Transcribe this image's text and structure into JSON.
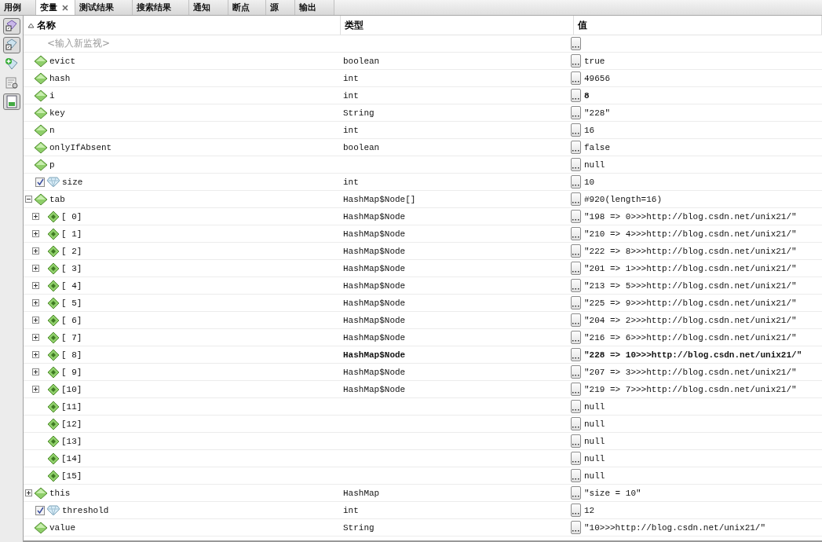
{
  "tabs": [
    {
      "label": "用例",
      "selected": false
    },
    {
      "label": "变量",
      "selected": true
    },
    {
      "label": "测试结果",
      "selected": false
    },
    {
      "label": "搜索结果",
      "selected": false
    },
    {
      "label": "通知",
      "selected": false
    },
    {
      "label": "断点",
      "selected": false
    },
    {
      "label": "源",
      "selected": false
    },
    {
      "label": "输出",
      "selected": false
    }
  ],
  "toolbar": [
    {
      "selected": true
    },
    {
      "selected": true
    },
    {
      "selected": false
    },
    {
      "selected": false
    },
    {
      "selected": true
    }
  ],
  "columns": [
    {
      "label": "名称",
      "sorted": true
    },
    {
      "label": "类型",
      "sorted": false
    },
    {
      "label": "值",
      "sorted": false
    }
  ],
  "new_watch": {
    "placeholder": "<输入新监视>"
  },
  "rows": [
    {
      "kind": "field",
      "name": "evict",
      "type": "boolean",
      "value": "true",
      "changed": false,
      "type_changed": false
    },
    {
      "kind": "field",
      "name": "hash",
      "type": "int",
      "value": "49656",
      "changed": false,
      "type_changed": false
    },
    {
      "kind": "field",
      "name": "i",
      "type": "int",
      "value": "8",
      "changed": true,
      "type_changed": false
    },
    {
      "kind": "field",
      "name": "key",
      "type": "String",
      "value": "\"228\"",
      "changed": false,
      "type_changed": false
    },
    {
      "kind": "field",
      "name": "n",
      "type": "int",
      "value": "16",
      "changed": false,
      "type_changed": false
    },
    {
      "kind": "field",
      "name": "onlyIfAbsent",
      "type": "boolean",
      "value": "false",
      "changed": false,
      "type_changed": false
    },
    {
      "kind": "field",
      "name": "p",
      "value": "null",
      "changed": false
    },
    {
      "kind": "watch",
      "checked": true,
      "name": "size",
      "type": "int",
      "value": "10",
      "changed": false,
      "type_changed": false
    },
    {
      "kind": "field",
      "name": "tab",
      "type": "HashMap$Node[]",
      "value": "#920(length=16)",
      "changed": false,
      "type_changed": false,
      "expanded": true,
      "children": [
        {
          "kind": "element",
          "name": "[ 0]",
          "type": "HashMap$Node",
          "value": "\"198 => 0>>>http://blog.csdn.net/unix21/\"",
          "changed": false,
          "type_changed": false,
          "expanded": false
        },
        {
          "kind": "element",
          "name": "[ 1]",
          "type": "HashMap$Node",
          "value": "\"210 => 4>>>http://blog.csdn.net/unix21/\"",
          "changed": false,
          "type_changed": false,
          "expanded": false
        },
        {
          "kind": "element",
          "name": "[ 2]",
          "type": "HashMap$Node",
          "value": "\"222 => 8>>>http://blog.csdn.net/unix21/\"",
          "changed": false,
          "type_changed": false,
          "expanded": false
        },
        {
          "kind": "element",
          "name": "[ 3]",
          "type": "HashMap$Node",
          "value": "\"201 => 1>>>http://blog.csdn.net/unix21/\"",
          "changed": false,
          "type_changed": false,
          "expanded": false
        },
        {
          "kind": "element",
          "name": "[ 4]",
          "type": "HashMap$Node",
          "value": "\"213 => 5>>>http://blog.csdn.net/unix21/\"",
          "changed": false,
          "type_changed": false,
          "expanded": false
        },
        {
          "kind": "element",
          "name": "[ 5]",
          "type": "HashMap$Node",
          "value": "\"225 => 9>>>http://blog.csdn.net/unix21/\"",
          "changed": false,
          "type_changed": false,
          "expanded": false
        },
        {
          "kind": "element",
          "name": "[ 6]",
          "type": "HashMap$Node",
          "value": "\"204 => 2>>>http://blog.csdn.net/unix21/\"",
          "changed": false,
          "type_changed": false,
          "expanded": false
        },
        {
          "kind": "element",
          "name": "[ 7]",
          "type": "HashMap$Node",
          "value": "\"216 => 6>>>http://blog.csdn.net/unix21/\"",
          "changed": false,
          "type_changed": false,
          "expanded": false
        },
        {
          "kind": "element",
          "name": "[ 8]",
          "type": "HashMap$Node",
          "value": "\"228 => 10>>>http://blog.csdn.net/unix21/\"",
          "changed": true,
          "type_changed": true,
          "expanded": false
        },
        {
          "kind": "element",
          "name": "[ 9]",
          "type": "HashMap$Node",
          "value": "\"207 => 3>>>http://blog.csdn.net/unix21/\"",
          "changed": false,
          "type_changed": false,
          "expanded": false
        },
        {
          "kind": "element",
          "name": "[10]",
          "type": "HashMap$Node",
          "value": "\"219 => 7>>>http://blog.csdn.net/unix21/\"",
          "changed": false,
          "type_changed": false,
          "expanded": false
        },
        {
          "kind": "element",
          "name": "[11]",
          "value": "null",
          "changed": false
        },
        {
          "kind": "element",
          "name": "[12]",
          "value": "null",
          "changed": false
        },
        {
          "kind": "element",
          "name": "[13]",
          "value": "null",
          "changed": false
        },
        {
          "kind": "element",
          "name": "[14]",
          "value": "null",
          "changed": false
        },
        {
          "kind": "element",
          "name": "[15]",
          "value": "null",
          "changed": false
        }
      ]
    },
    {
      "kind": "field",
      "name": "this",
      "type": "HashMap",
      "value": "\"size = 10\"",
      "changed": false,
      "type_changed": false,
      "expanded": false
    },
    {
      "kind": "watch",
      "checked": true,
      "name": "threshold",
      "type": "int",
      "value": "12",
      "changed": false,
      "type_changed": false
    },
    {
      "kind": "field",
      "name": "value",
      "type": "String",
      "value": "\"10>>>http://blog.csdn.net/unix21/\"",
      "changed": false,
      "type_changed": false
    }
  ]
}
